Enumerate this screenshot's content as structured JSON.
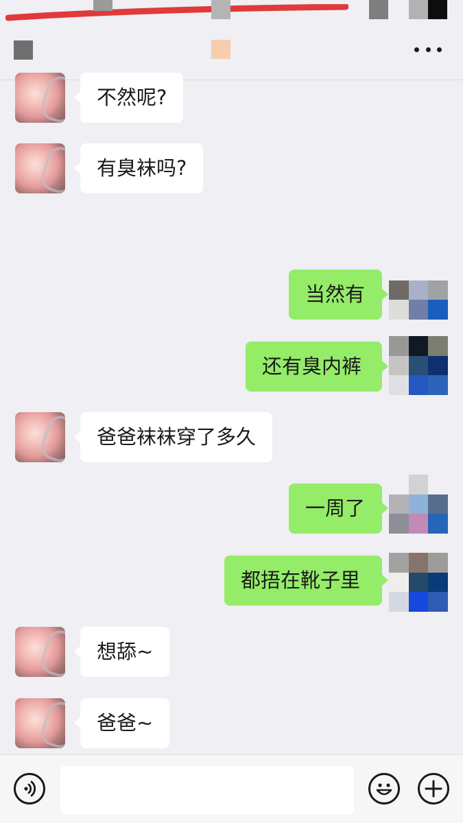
{
  "status_bar": {},
  "nav": {
    "more_icon": "more-dots-icon"
  },
  "messages": [
    {
      "side": "in",
      "text": "不然呢?"
    },
    {
      "side": "in",
      "text": "有臭袜吗?"
    },
    {
      "side": "out",
      "text": "当然有"
    },
    {
      "side": "out",
      "text": "还有臭内裤"
    },
    {
      "side": "in",
      "text": "爸爸袜袜穿了多久"
    },
    {
      "side": "out",
      "text": "一周了"
    },
    {
      "side": "out",
      "text": "都捂在靴子里"
    },
    {
      "side": "in",
      "text": "想舔~"
    },
    {
      "side": "in",
      "text": "爸爸~"
    }
  ],
  "input_bar": {
    "voice_icon": "voice-icon",
    "text_value": "",
    "emoji_icon": "emoji-icon",
    "add_icon": "plus-icon"
  },
  "colors": {
    "background": "#efeff4",
    "incoming_bubble": "#ffffff",
    "outgoing_bubble": "#95ec69"
  }
}
